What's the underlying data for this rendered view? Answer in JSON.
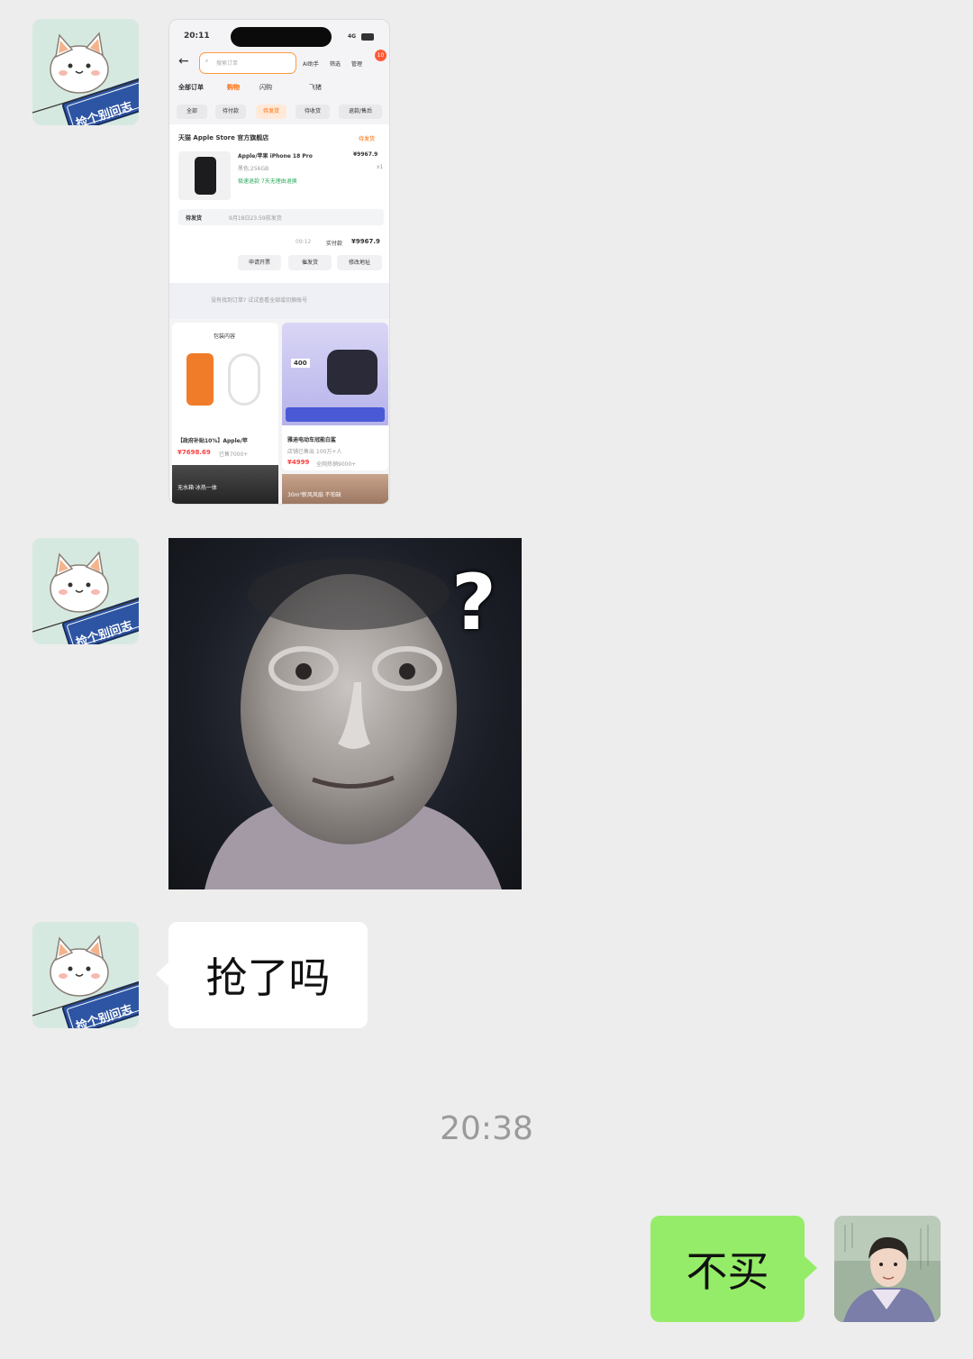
{
  "timestamp": "20:38",
  "incoming": {
    "avatar_sign": "捡个别问志",
    "text_message": "抢了吗",
    "meme_mark": "?"
  },
  "outgoing": {
    "text_message": "不买"
  },
  "screenshot": {
    "status_time": "20:11",
    "status_right": "4G",
    "search_placeholder": "搜索订单",
    "top_tools": [
      "AI助手",
      "筛选",
      "管理"
    ],
    "badge_count": "10",
    "main_tabs": [
      "全部订单",
      "购物",
      "闪购",
      "飞猪"
    ],
    "sub_tabs": [
      "全部",
      "待付款",
      "待发货",
      "待收货",
      "退款/售后"
    ],
    "store_name": "天猫 Apple Store 官方旗舰店",
    "order_status": "待发货",
    "product_name": "Apple/苹果 iPhone 18 Pro",
    "product_price": "¥9967.9",
    "product_spec": "黑色;256GB",
    "product_qty": "x1",
    "service_tags": "极速退款  7天无理由退换",
    "ship_notice_label": "待发货",
    "ship_notice_text": "9月18日23:59前发货",
    "order_time": "09:12",
    "paid_label": "实付款",
    "paid_amount": "¥9967.9",
    "actions": [
      "申请开票",
      "催发货",
      "修改地址"
    ],
    "not_found_hint": "没有找到订单? 试试查看全部或切换账号",
    "rec1_label": "包装内容",
    "rec1_title": "【政府补贴10%】Apple/苹",
    "rec1_price": "¥7698.69",
    "rec1_sold": "已售7000+",
    "rec2_title": "雅迪电动车冠能白鲨",
    "rec2_sub": "店铺已售出 100万+人",
    "rec2_price": "¥4999",
    "rec2_hot": "全网热销9000+",
    "rec2_promo": "400",
    "rec3_text": "无水箱·冰热一体",
    "rec4_text": "30m³新风风扇 不怕缺"
  },
  "colors": {
    "background": "#ededed",
    "bubble_out": "#95ec69",
    "bubble_in": "#ffffff",
    "accent_orange": "#ff6a00"
  }
}
